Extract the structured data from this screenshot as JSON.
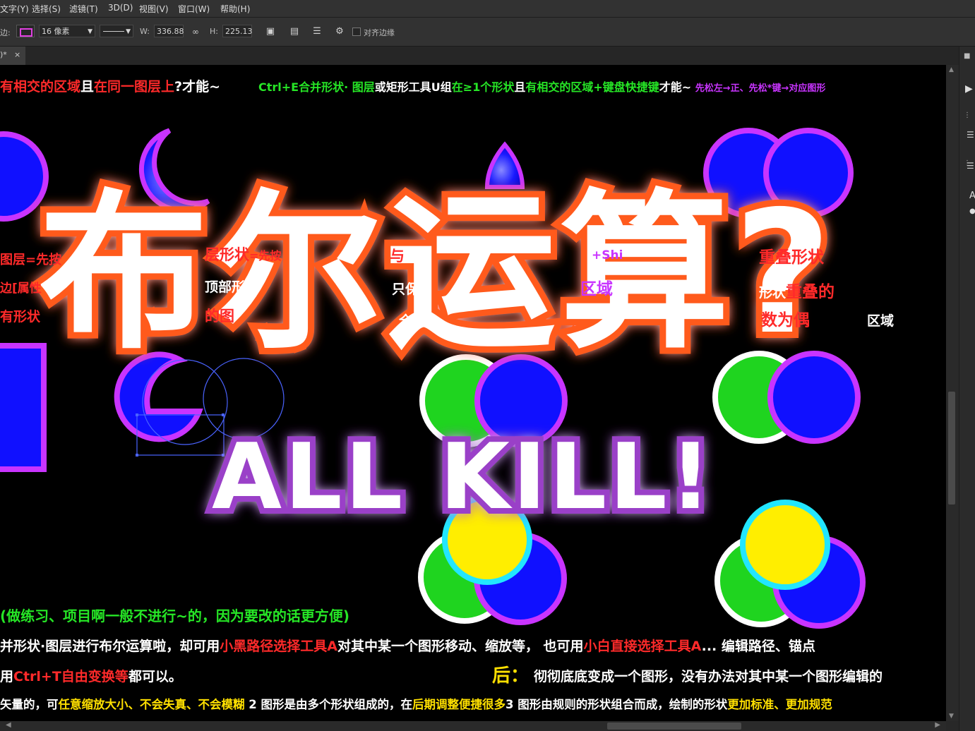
{
  "menu": [
    "文字(Y)",
    "选择(S)",
    "滤镜(T)",
    "3D(D)",
    "视图(V)",
    "窗口(W)",
    "帮助(H)"
  ],
  "options": {
    "stroke_label": "边:",
    "stroke_size": "16 像素",
    "w_label": "W:",
    "w_value": "336.88",
    "h_label": "H:",
    "h_value": "225.13",
    "align_edges": "对齐边缘"
  },
  "tab": {
    "label": ")*",
    "close": "×"
  },
  "canvas_text": {
    "top_left_a": "有相交的区域",
    "top_left_b": "且",
    "top_left_c": "在同一图层上",
    "top_left_d": "?才能~",
    "top_right_a": "Ctrl+E合并形状·",
    "top_right_b": "图层",
    "top_right_c": "或矩形工具U组",
    "top_right_d": "在≥1个形状",
    "top_right_e": "且",
    "top_right_f": "有相交的区域+键盘快捷键",
    "top_right_g": "才能~",
    "top_right_h": "先松左→正、先松*键→对应图形",
    "row1_a": "图层=先按",
    "row1_b": "层形状",
    "row1_c": "=先按",
    "row1_d": "与",
    "row1_e": "+Shi",
    "row1_f": "重叠形状",
    "row2_a": "边[属性",
    "row2_b": "顶部形",
    "row2_c": "只保",
    "row2_d": "区域",
    "row2_e": "形状",
    "row2_f": "重叠的",
    "row3_a": "有形状",
    "row3_b": "的图",
    "row3_c": "全",
    "row3_d": "数为偶",
    "row3_e": "区域",
    "title_big": "布尔运算?",
    "allkill": "ALL KILL!",
    "bottom1": "(做练习、项目啊一般不进行~的，因为要改的话更方便)",
    "bottom2_a": "并形状·图层进行布尔运算啦，却可用",
    "bottom2_b": "小黑路径选择工具A",
    "bottom2_c": "对其中某一个图形移动、缩放等，  也可用",
    "bottom2_d": "小白直接选择工具A",
    "bottom2_e": "... 编辑路径、锚点",
    "bottom3_a": "用",
    "bottom3_b": "Ctrl+T自由变换等",
    "bottom3_c": "都可以。",
    "bottom3_d": "后：",
    "bottom3_e": "彻彻底底变成一个图形，没有办法对其中某一个图形编辑的",
    "bottom4_a": "矢量的，可",
    "bottom4_b": "任意缩放大小、不会失真、不会模糊",
    "bottom4_c": "  2 图形是由多个形状组成的，在",
    "bottom4_d": "后期调整便捷很多",
    "bottom4_e": "3 图形由规则的形状组合而成，绘制的形状",
    "bottom4_f": "更加标准、更加规范"
  },
  "colors": {
    "red": "#ff2a2a",
    "green": "#26e626",
    "magenta": "#c934ff",
    "yellow": "#ffe000",
    "orange": "#ff5a1f",
    "purple": "#9a40c8",
    "blue": "#1010ff"
  }
}
